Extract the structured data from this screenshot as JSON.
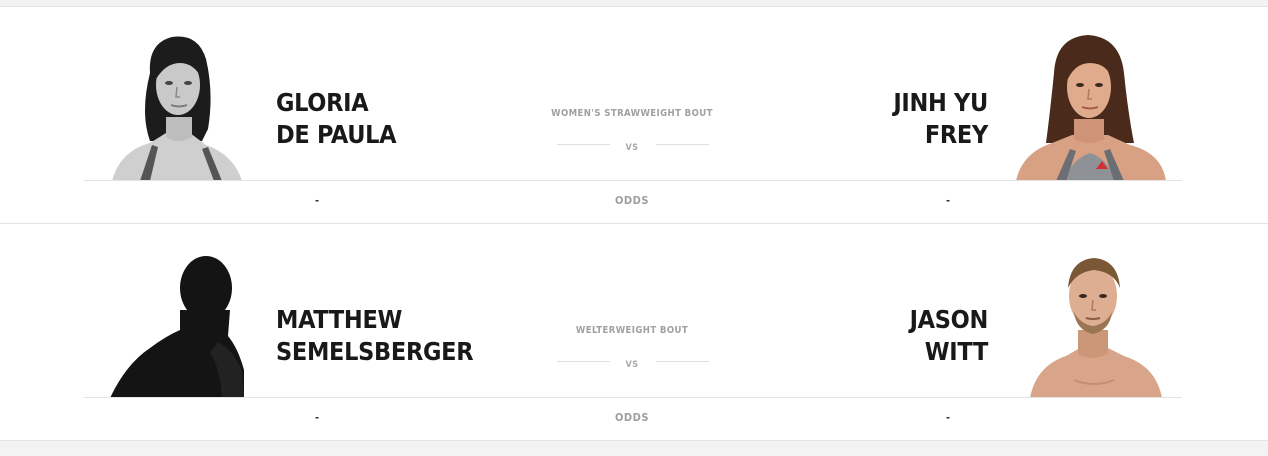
{
  "fights": [
    {
      "red_corner": {
        "first_name": "GLORIA",
        "last_name": "DE PAULA",
        "odds": "-"
      },
      "blue_corner": {
        "first_name": "JINH YU",
        "last_name": "FREY",
        "odds": "-"
      },
      "weight_class": "WOMEN'S STRAWWEIGHT BOUT",
      "vs_label": "VS",
      "odds_label": "ODDS"
    },
    {
      "red_corner": {
        "first_name": "MATTHEW",
        "last_name": "SEMELSBERGER",
        "odds": "-"
      },
      "blue_corner": {
        "first_name": "JASON",
        "last_name": "WITT",
        "odds": "-"
      },
      "weight_class": "WELTERWEIGHT BOUT",
      "vs_label": "VS",
      "odds_label": "ODDS"
    }
  ],
  "colors": {
    "page_background": "#f3f3f3",
    "card_background": "#ffffff",
    "name_text": "#191919",
    "muted_text": "#a0a0a0",
    "divider": "#e4e4e4"
  },
  "icons": {
    "fighter_1_red": "fighter-headshot-grayscale",
    "fighter_1_blue": "fighter-headshot-color",
    "fighter_2_red": "fighter-silhouette",
    "fighter_2_blue": "fighter-headshot-color"
  }
}
